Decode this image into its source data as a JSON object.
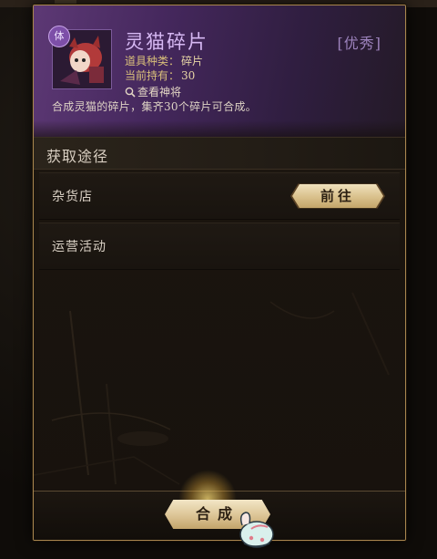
{
  "item": {
    "name": "灵猫碎片",
    "quality": "[优秀]",
    "badge": "体",
    "type_label": "道具种类：",
    "type_value": "碎片",
    "held_label": "当前持有：",
    "held_value": "30",
    "view_link": "查看神将",
    "description": "合成灵猫的碎片，集齐30个碎片可合成。"
  },
  "sources": {
    "title": "获取途径",
    "rows": [
      {
        "label": "杂货店",
        "button": "前往"
      },
      {
        "label": "运营活动"
      }
    ]
  },
  "synthesize_button": "合成",
  "colors": {
    "header_purple": "#603a7a",
    "item_name": "#d6b8f3",
    "gold_button": "#dcc495",
    "panel_border": "#a8864f"
  },
  "icons": [
    "fragment-badge-icon",
    "search-icon",
    "tap-hand-icon"
  ]
}
